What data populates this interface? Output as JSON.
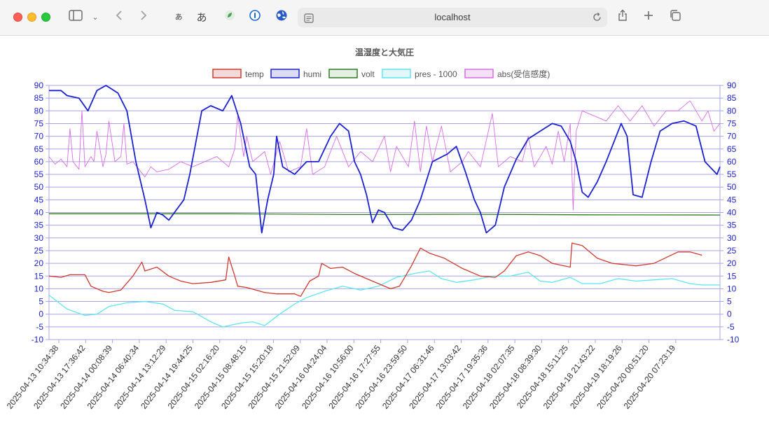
{
  "browser": {
    "url": "localhost",
    "ext_icons": [
      "ぁ",
      "あ"
    ]
  },
  "chart_data": {
    "type": "line",
    "title": "温湿度と大気圧",
    "xlabel": "",
    "ylabel": "",
    "ylim": [
      -10,
      90
    ],
    "y_ticks": [
      -10,
      -5,
      0,
      5,
      10,
      15,
      20,
      25,
      30,
      35,
      40,
      45,
      50,
      55,
      60,
      65,
      70,
      75,
      80,
      85,
      90
    ],
    "grid": true,
    "legend_position": "top",
    "categories": [
      "2025-04-13 10:34:38",
      "2025-04-13 17:36:42",
      "2025-04-14 00:08:39",
      "2025-04-14 06:40:34",
      "2025-04-14 13:12:29",
      "2025-04-14 19:44:25",
      "2025-04-15 02:16:20",
      "2025-04-15 08:48:15",
      "2025-04-15 15:20:18",
      "2025-04-15 21:52:09",
      "2025-04-16 04:24:04",
      "2025-04-16 10:56:00",
      "2025-04-16 17:27:55",
      "2025-04-16 23:59:50",
      "2025-04-17 06:31:46",
      "2025-04-17 13:03:42",
      "2025-04-17 19:35:36",
      "2025-04-18 02:07:35",
      "2025-04-18 08:39:30",
      "2025-04-18 15:11:25",
      "2025-04-18 21:43:22",
      "2025-04-19 18:19:26",
      "2025-04-20 00:51:20",
      "2025-04-20 07:23:19"
    ],
    "series": [
      {
        "name": "temp",
        "color": "#d03a2c",
        "fill": "#f3dada",
        "values": [
          [
            0,
            15
          ],
          [
            0.02,
            14.5
          ],
          [
            0.035,
            15.5
          ],
          [
            0.06,
            15.5
          ],
          [
            0.07,
            11
          ],
          [
            0.09,
            9
          ],
          [
            0.1,
            8.5
          ],
          [
            0.12,
            9.5
          ],
          [
            0.14,
            15
          ],
          [
            0.155,
            20.5
          ],
          [
            0.16,
            17
          ],
          [
            0.18,
            18.5
          ],
          [
            0.2,
            15
          ],
          [
            0.22,
            13
          ],
          [
            0.24,
            12
          ],
          [
            0.27,
            12.5
          ],
          [
            0.295,
            13.5
          ],
          [
            0.3,
            22.5
          ],
          [
            0.31,
            15
          ],
          [
            0.315,
            11
          ],
          [
            0.33,
            10.5
          ],
          [
            0.36,
            8.5
          ],
          [
            0.38,
            8
          ],
          [
            0.41,
            8
          ],
          [
            0.42,
            7
          ],
          [
            0.435,
            13
          ],
          [
            0.45,
            15
          ],
          [
            0.455,
            20
          ],
          [
            0.47,
            18
          ],
          [
            0.49,
            18.5
          ],
          [
            0.51,
            16
          ],
          [
            0.53,
            14
          ],
          [
            0.55,
            12
          ],
          [
            0.57,
            10
          ],
          [
            0.585,
            11
          ],
          [
            0.605,
            19
          ],
          [
            0.62,
            26
          ],
          [
            0.635,
            24
          ],
          [
            0.66,
            22
          ],
          [
            0.69,
            18
          ],
          [
            0.72,
            15
          ],
          [
            0.745,
            14.5
          ],
          [
            0.76,
            17
          ],
          [
            0.78,
            23
          ],
          [
            0.8,
            24.5
          ],
          [
            0.82,
            23
          ],
          [
            0.84,
            20
          ],
          [
            0.87,
            18.5
          ],
          [
            0.873,
            28
          ],
          [
            0.89,
            27
          ],
          [
            0.915,
            22
          ],
          [
            0.94,
            20
          ],
          [
            0.96,
            19.5
          ],
          [
            0.98,
            19
          ],
          [
            1.01,
            20
          ],
          [
            1.05,
            24.5
          ],
          [
            1.07,
            24.5
          ],
          [
            1.09,
            23.2
          ]
        ]
      },
      {
        "name": "humi",
        "color": "#1c22cf",
        "fill": "#dcdcf3",
        "values": [
          [
            0,
            88
          ],
          [
            0.02,
            88
          ],
          [
            0.03,
            86
          ],
          [
            0.05,
            85
          ],
          [
            0.065,
            80
          ],
          [
            0.08,
            88
          ],
          [
            0.095,
            90
          ],
          [
            0.115,
            87
          ],
          [
            0.13,
            80
          ],
          [
            0.145,
            60
          ],
          [
            0.16,
            45
          ],
          [
            0.17,
            34
          ],
          [
            0.18,
            40
          ],
          [
            0.19,
            39
          ],
          [
            0.2,
            37
          ],
          [
            0.225,
            45
          ],
          [
            0.235,
            55
          ],
          [
            0.255,
            80
          ],
          [
            0.27,
            82
          ],
          [
            0.29,
            80
          ],
          [
            0.305,
            86
          ],
          [
            0.32,
            75
          ],
          [
            0.335,
            58
          ],
          [
            0.345,
            55
          ],
          [
            0.355,
            32
          ],
          [
            0.365,
            45
          ],
          [
            0.375,
            55
          ],
          [
            0.38,
            70
          ],
          [
            0.39,
            58
          ],
          [
            0.41,
            55
          ],
          [
            0.43,
            60
          ],
          [
            0.45,
            60
          ],
          [
            0.47,
            70
          ],
          [
            0.485,
            75
          ],
          [
            0.5,
            72
          ],
          [
            0.51,
            60
          ],
          [
            0.52,
            55
          ],
          [
            0.53,
            47
          ],
          [
            0.54,
            36
          ],
          [
            0.55,
            41
          ],
          [
            0.56,
            40
          ],
          [
            0.575,
            34
          ],
          [
            0.59,
            33
          ],
          [
            0.605,
            37
          ],
          [
            0.62,
            45
          ],
          [
            0.64,
            60
          ],
          [
            0.665,
            63
          ],
          [
            0.68,
            66
          ],
          [
            0.695,
            56
          ],
          [
            0.71,
            45
          ],
          [
            0.72,
            40
          ],
          [
            0.73,
            32
          ],
          [
            0.745,
            35
          ],
          [
            0.76,
            50
          ],
          [
            0.78,
            61
          ],
          [
            0.8,
            69
          ],
          [
            0.82,
            72
          ],
          [
            0.84,
            75
          ],
          [
            0.855,
            74
          ],
          [
            0.87,
            68
          ],
          [
            0.88,
            60
          ],
          [
            0.89,
            48
          ],
          [
            0.9,
            46
          ],
          [
            0.915,
            52
          ],
          [
            0.93,
            60
          ],
          [
            0.955,
            75
          ],
          [
            0.965,
            70
          ],
          [
            0.975,
            47
          ],
          [
            0.99,
            46
          ],
          [
            1.005,
            60
          ],
          [
            1.02,
            72
          ],
          [
            1.04,
            75
          ],
          [
            1.06,
            76
          ],
          [
            1.08,
            74
          ],
          [
            1.095,
            60
          ],
          [
            1.115,
            55
          ],
          [
            1.12,
            58
          ]
        ]
      },
      {
        "name": "volt",
        "color": "#2d7d1e",
        "fill": "#e6efe3",
        "values": [
          [
            0,
            39.5
          ],
          [
            0.3,
            39.5
          ],
          [
            0.5,
            39.2
          ],
          [
            0.7,
            39.3
          ],
          [
            0.9,
            39.1
          ],
          [
            1.12,
            39
          ]
        ]
      },
      {
        "name": "pres - 1000",
        "color": "#5ee6f0",
        "fill": "#e3f7f9",
        "values": [
          [
            0,
            7.5
          ],
          [
            0.03,
            2
          ],
          [
            0.06,
            -0.5
          ],
          [
            0.08,
            0
          ],
          [
            0.1,
            3
          ],
          [
            0.13,
            4.5
          ],
          [
            0.16,
            5
          ],
          [
            0.19,
            4
          ],
          [
            0.21,
            1.5
          ],
          [
            0.24,
            1
          ],
          [
            0.27,
            -3
          ],
          [
            0.29,
            -5
          ],
          [
            0.32,
            -3.5
          ],
          [
            0.34,
            -3
          ],
          [
            0.36,
            -4.5
          ],
          [
            0.385,
            0
          ],
          [
            0.41,
            4
          ],
          [
            0.43,
            6.5
          ],
          [
            0.46,
            9
          ],
          [
            0.49,
            11
          ],
          [
            0.52,
            9.5
          ],
          [
            0.55,
            11
          ],
          [
            0.58,
            14.5
          ],
          [
            0.61,
            16
          ],
          [
            0.635,
            17
          ],
          [
            0.655,
            14
          ],
          [
            0.68,
            12.5
          ],
          [
            0.71,
            13.5
          ],
          [
            0.74,
            15
          ],
          [
            0.77,
            15
          ],
          [
            0.8,
            16.5
          ],
          [
            0.82,
            13
          ],
          [
            0.84,
            12.5
          ],
          [
            0.87,
            14.5
          ],
          [
            0.89,
            12
          ],
          [
            0.92,
            12
          ],
          [
            0.95,
            14
          ],
          [
            0.98,
            13
          ],
          [
            1.01,
            13.5
          ],
          [
            1.04,
            14
          ],
          [
            1.07,
            12
          ],
          [
            1.09,
            11.5
          ],
          [
            1.12,
            11.5
          ]
        ]
      },
      {
        "name": "abs(受信感度)",
        "color": "#d86de5",
        "fill": "#f3e2f5",
        "values": [
          [
            0,
            62
          ],
          [
            0.01,
            59
          ],
          [
            0.02,
            61
          ],
          [
            0.03,
            58
          ],
          [
            0.035,
            73
          ],
          [
            0.04,
            60
          ],
          [
            0.05,
            57
          ],
          [
            0.055,
            80
          ],
          [
            0.06,
            58
          ],
          [
            0.07,
            62
          ],
          [
            0.075,
            60
          ],
          [
            0.08,
            72
          ],
          [
            0.09,
            58
          ],
          [
            0.095,
            63
          ],
          [
            0.1,
            76
          ],
          [
            0.11,
            60
          ],
          [
            0.12,
            62
          ],
          [
            0.125,
            75
          ],
          [
            0.13,
            59
          ],
          [
            0.14,
            60
          ],
          [
            0.15,
            57
          ],
          [
            0.16,
            54
          ],
          [
            0.17,
            58
          ],
          [
            0.18,
            56
          ],
          [
            0.2,
            57
          ],
          [
            0.22,
            60
          ],
          [
            0.24,
            58
          ],
          [
            0.26,
            60
          ],
          [
            0.28,
            62
          ],
          [
            0.3,
            58
          ],
          [
            0.31,
            65
          ],
          [
            0.315,
            78
          ],
          [
            0.325,
            62
          ],
          [
            0.33,
            70
          ],
          [
            0.34,
            60
          ],
          [
            0.36,
            64
          ],
          [
            0.37,
            55
          ],
          [
            0.385,
            68
          ],
          [
            0.4,
            56
          ],
          [
            0.42,
            58
          ],
          [
            0.43,
            73
          ],
          [
            0.44,
            55
          ],
          [
            0.46,
            58
          ],
          [
            0.48,
            70
          ],
          [
            0.5,
            58
          ],
          [
            0.52,
            64
          ],
          [
            0.54,
            60
          ],
          [
            0.56,
            70
          ],
          [
            0.57,
            56
          ],
          [
            0.58,
            66
          ],
          [
            0.6,
            58
          ],
          [
            0.61,
            76
          ],
          [
            0.62,
            56
          ],
          [
            0.63,
            74
          ],
          [
            0.64,
            60
          ],
          [
            0.655,
            74
          ],
          [
            0.67,
            56
          ],
          [
            0.69,
            60
          ],
          [
            0.7,
            64
          ],
          [
            0.72,
            58
          ],
          [
            0.74,
            79
          ],
          [
            0.75,
            58
          ],
          [
            0.77,
            62
          ],
          [
            0.79,
            60
          ],
          [
            0.8,
            70
          ],
          [
            0.81,
            58
          ],
          [
            0.83,
            66
          ],
          [
            0.84,
            59
          ],
          [
            0.85,
            72
          ],
          [
            0.86,
            60
          ],
          [
            0.87,
            75
          ],
          [
            0.875,
            41
          ],
          [
            0.88,
            72
          ],
          [
            0.89,
            80
          ],
          [
            0.91,
            78
          ],
          [
            0.93,
            76
          ],
          [
            0.95,
            82
          ],
          [
            0.97,
            76
          ],
          [
            0.99,
            82
          ],
          [
            1.01,
            74
          ],
          [
            1.03,
            80
          ],
          [
            1.05,
            80
          ],
          [
            1.07,
            84
          ],
          [
            1.09,
            76
          ],
          [
            1.1,
            80
          ],
          [
            1.11,
            72
          ],
          [
            1.12,
            75
          ]
        ]
      }
    ]
  }
}
